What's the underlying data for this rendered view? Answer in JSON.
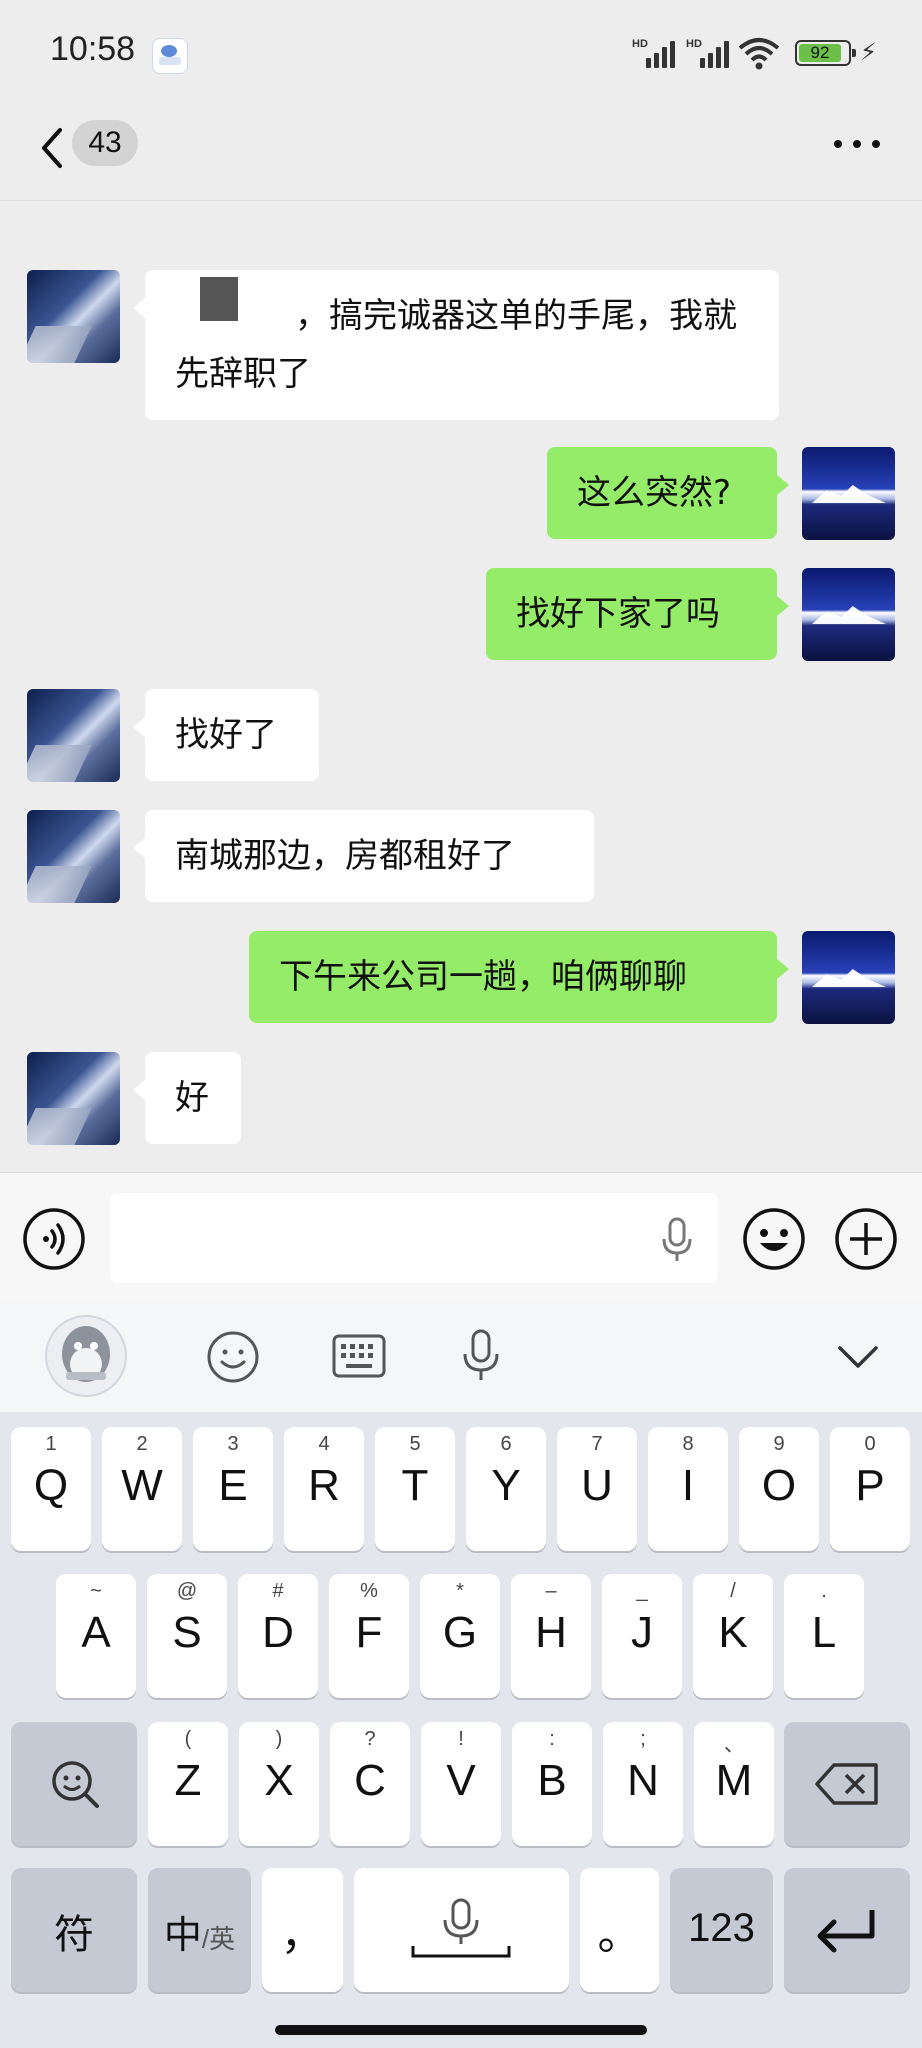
{
  "status_bar": {
    "time": "10:58",
    "battery_level": "92",
    "network_label_1": "HD",
    "network_label_2": "HD"
  },
  "header": {
    "unread_count": "43"
  },
  "messages": [
    {
      "side": "left",
      "text_line1": "，搞完诚器这单的手尾，我就",
      "text_line2": "先辞职了"
    },
    {
      "side": "right",
      "text": "这么突然?"
    },
    {
      "side": "right",
      "text": "找好下家了吗"
    },
    {
      "side": "left",
      "text": "找好了"
    },
    {
      "side": "left",
      "text": "南城那边，房都租好了"
    },
    {
      "side": "right",
      "text": "下午来公司一趟，咱俩聊聊"
    },
    {
      "side": "left",
      "text": "好"
    }
  ],
  "input": {
    "value": ""
  },
  "keyboard": {
    "row1": [
      {
        "k": "Q",
        "s": "1"
      },
      {
        "k": "W",
        "s": "2"
      },
      {
        "k": "E",
        "s": "3"
      },
      {
        "k": "R",
        "s": "4"
      },
      {
        "k": "T",
        "s": "5"
      },
      {
        "k": "Y",
        "s": "6"
      },
      {
        "k": "U",
        "s": "7"
      },
      {
        "k": "I",
        "s": "8"
      },
      {
        "k": "O",
        "s": "9"
      },
      {
        "k": "P",
        "s": "0"
      }
    ],
    "row2": [
      {
        "k": "A",
        "s": "~"
      },
      {
        "k": "S",
        "s": "@"
      },
      {
        "k": "D",
        "s": "#"
      },
      {
        "k": "F",
        "s": "%"
      },
      {
        "k": "G",
        "s": "*"
      },
      {
        "k": "H",
        "s": "–"
      },
      {
        "k": "J",
        "s": "_"
      },
      {
        "k": "K",
        "s": "/"
      },
      {
        "k": "L",
        "s": "."
      }
    ],
    "row3": [
      {
        "k": "Z",
        "s": "("
      },
      {
        "k": "X",
        "s": ")"
      },
      {
        "k": "C",
        "s": "?"
      },
      {
        "k": "V",
        "s": "!"
      },
      {
        "k": "B",
        "s": ":"
      },
      {
        "k": "N",
        "s": ";"
      },
      {
        "k": "M",
        "s": "、"
      }
    ],
    "symbols_label": "符",
    "lang_label_main": "中",
    "lang_label_sub": "/英",
    "comma_label": "，",
    "period_label": "。",
    "numbers_label": "123"
  }
}
